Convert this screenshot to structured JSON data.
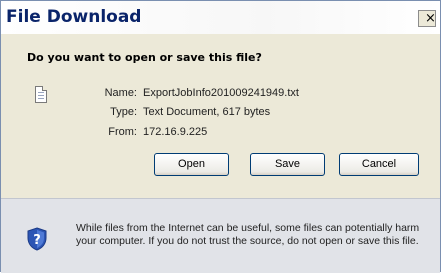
{
  "window": {
    "title": "File Download",
    "close_glyph": "×"
  },
  "dialog": {
    "question": "Do you want to open or save this file?",
    "file": {
      "icon": "text-file-icon",
      "name_label": "Name:",
      "name_value": "ExportJobInfo201009241949.txt",
      "type_label": "Type:",
      "type_value": "Text Document, 617 bytes",
      "from_label": "From:",
      "from_value": "172.16.9.225"
    },
    "buttons": {
      "open": "Open",
      "save": "Save",
      "cancel": "Cancel"
    },
    "warning": {
      "icon": "security-shield-icon",
      "text": "While files from the Internet can be useful, some files can potentially harm your computer. If you do not trust the source, do not open or save this file."
    }
  },
  "colors": {
    "title_text": "#0a246a",
    "dialog_bg": "#ece9d8",
    "warning_bg": "#e1e3e8",
    "button_border": "#003c74",
    "shield_blue": "#2c55b4"
  }
}
